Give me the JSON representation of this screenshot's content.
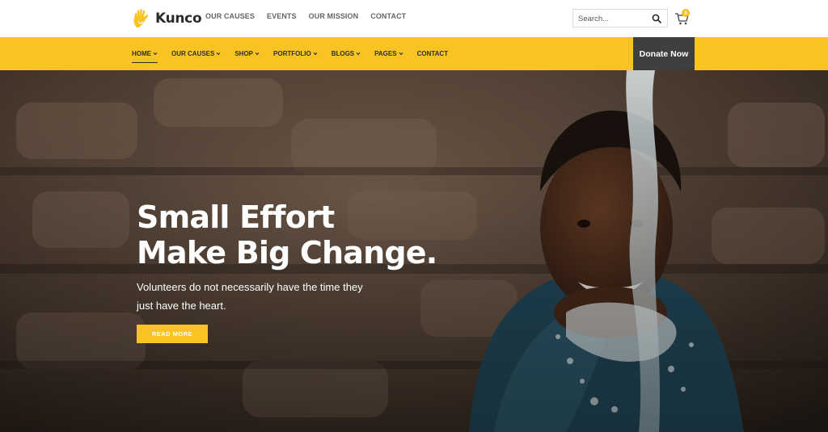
{
  "brand": {
    "name": "Kunco",
    "accent": "#f9c423",
    "dark": "#3f3f3f"
  },
  "topnav": [
    "OUR CAUSES",
    "EVENTS",
    "OUR MISSION",
    "CONTACT"
  ],
  "search": {
    "placeholder": "Search..."
  },
  "cart": {
    "count": "0"
  },
  "mainnav": [
    {
      "label": "HOME",
      "dropdown": true,
      "active": true
    },
    {
      "label": "OUR CAUSES",
      "dropdown": true
    },
    {
      "label": "SHOP",
      "dropdown": true
    },
    {
      "label": "PORTFOLIO",
      "dropdown": true
    },
    {
      "label": "BLOGS",
      "dropdown": true
    },
    {
      "label": "PAGES",
      "dropdown": true
    },
    {
      "label": "CONTACT",
      "dropdown": false
    }
  ],
  "donate_label": "Donate Now",
  "hero": {
    "title_line1": "Small Effort",
    "title_line2": "Make Big Change.",
    "subtitle_line1": "Volunteers do not necessarily have the time they",
    "subtitle_line2": "just have the heart.",
    "button": "READ MORE"
  }
}
